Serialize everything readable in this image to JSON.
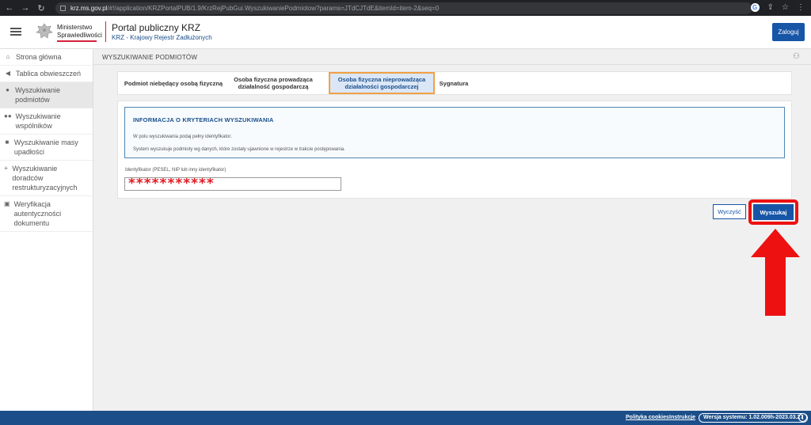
{
  "browser": {
    "url_host": "krz.ms.gov.pl",
    "url_path": "/#!/application/KRZPortalPUB/1.9/KrzRejPubGui.WyszukiwaniePodmiotow?params=JTdCJTdE&itemId=item-2&seq=0"
  },
  "header": {
    "ministry_line1": "Ministerstwo",
    "ministry_line2": "Sprawiedliwości",
    "portal_title": "Portal publiczny KRZ",
    "portal_subtitle": "KRZ - Krajowy Rejestr Zadłużonych",
    "login_label": "Zaloguj"
  },
  "sidebar": {
    "items": [
      {
        "label": "Strona główna",
        "icon": "home-icon"
      },
      {
        "label": "Tablica obwieszczeń",
        "icon": "megaphone-icon"
      },
      {
        "label": "Wyszukiwanie podmiotów",
        "icon": "person-search-icon",
        "active": true
      },
      {
        "label": "Wyszukiwanie wspólników",
        "icon": "people-icon"
      },
      {
        "label": "Wyszukiwanie masy upadłości",
        "icon": "car-icon"
      },
      {
        "label": "Wyszukiwanie doradców restrukturyzacyjnych",
        "icon": "person-add-icon"
      },
      {
        "label": "Weryfikacja autentyczności dokumentu",
        "icon": "verified-icon"
      }
    ]
  },
  "main": {
    "heading": "WYSZUKIWANIE PODMIOTÓW",
    "tabs": [
      {
        "label": "Podmiot niebędący osobą fizyczną"
      },
      {
        "label": "Osoba fizyczna prowadząca działalność gospodarczą"
      },
      {
        "label": "Osoba fizyczna nieprowadząca działalności gospodarczej",
        "active": true
      },
      {
        "label": "Sygnatura"
      }
    ],
    "info": {
      "title": "INFORMACJA O KRYTERIACH WYSZUKIWANIA",
      "line1": "W polu wyszukiwania podaj pełny identyfikator.",
      "line2": "System wyszukuje podmioty wg danych, które zostały ujawnione w rejestrze w trakcie postępowania."
    },
    "field": {
      "label": "Identyfikator (PESEL, NIP lub inny identyfikator)",
      "value": "***********"
    },
    "clear_label": "Wyczyść",
    "search_label": "Wyszukaj"
  },
  "footer": {
    "privacy": "Polityka cookies",
    "instructions": "Instrukcje",
    "version": "Wersja systemu: 1.02.009h-2023.03.27"
  },
  "colors": {
    "brand_blue": "#1755a7",
    "highlight_red": "#ee1111",
    "footer_blue": "#1c4f8a"
  }
}
